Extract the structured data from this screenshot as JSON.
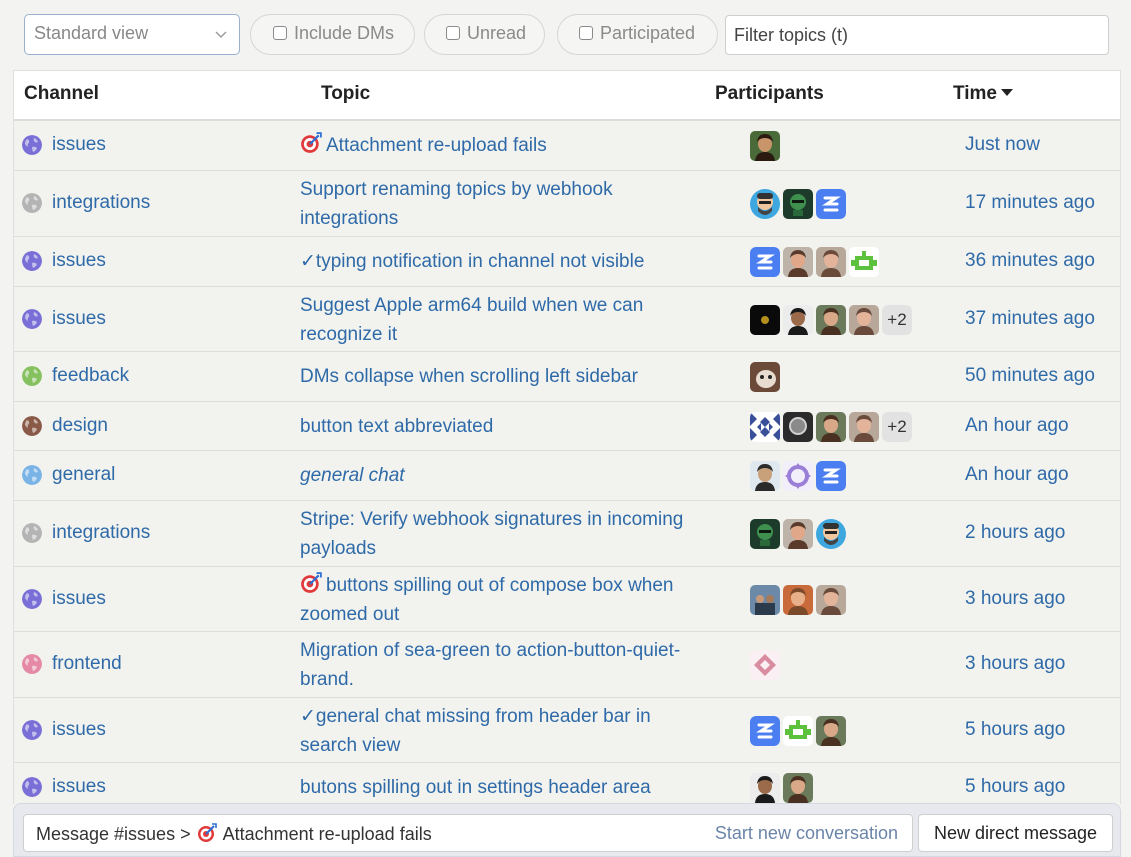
{
  "filters": {
    "view_select": "Standard view",
    "include_dms": "Include DMs",
    "unread": "Unread",
    "participated": "Participated",
    "topic_filter_placeholder": "Filter topics (t)"
  },
  "table": {
    "headers": {
      "channel": "Channel",
      "topic": "Topic",
      "participants": "Participants",
      "time": "Time"
    },
    "rows": [
      {
        "channel": "issues",
        "globe_color": "#7a6fd6",
        "topic": "Attachment re-upload fails",
        "prefix": "target-icon",
        "time": "Just now",
        "avatars": [
          "photo-man-1"
        ],
        "more": ""
      },
      {
        "channel": "integrations",
        "globe_color": "#b4b4b4",
        "topic_line1": "Support renaming topics by webhook",
        "topic_line2": "integrations",
        "time": "17 minutes ago",
        "avatars": [
          "cartoon-man",
          "green-robot",
          "zulip-logo"
        ],
        "more": ""
      },
      {
        "channel": "issues",
        "globe_color": "#7a6fd6",
        "topic": "typing notification in channel not visible",
        "prefix": "check",
        "time": "36 minutes ago",
        "avatars": [
          "zulip-logo",
          "photo-man-2",
          "photo-man-3",
          "green-pixel"
        ],
        "more": ""
      },
      {
        "channel": "issues",
        "globe_color": "#7a6fd6",
        "topic_line1": "Suggest Apple arm64 build when we can",
        "topic_line2": "recognize it",
        "time": "37 minutes ago",
        "avatars": [
          "dark-glow",
          "photo-man-4",
          "photo-woman-1",
          "photo-man-3"
        ],
        "more": "+2"
      },
      {
        "channel": "feedback",
        "globe_color": "#86c15f",
        "topic": "DMs collapse when scrolling left sidebar",
        "time": "50 minutes ago",
        "avatars": [
          "cat-photo"
        ],
        "more": ""
      },
      {
        "channel": "design",
        "globe_color": "#8a5a48",
        "topic": "button text abbreviated",
        "time": "An hour ago",
        "avatars": [
          "blue-pattern",
          "photo-dark",
          "photo-woman-1",
          "photo-man-3"
        ],
        "more": "+2"
      },
      {
        "channel": "general",
        "globe_color": "#7ab4e6",
        "topic": "general chat",
        "italic": true,
        "time": "An hour ago",
        "avatars": [
          "photo-man-5",
          "purple-pattern",
          "zulip-logo"
        ],
        "more": ""
      },
      {
        "channel": "integrations",
        "globe_color": "#b4b4b4",
        "topic_line1": "Stripe: Verify webhook signatures in incoming",
        "topic_line2": "payloads",
        "time": "2 hours ago",
        "avatars": [
          "green-robot",
          "photo-man-2",
          "cartoon-man"
        ],
        "more": ""
      },
      {
        "channel": "issues",
        "globe_color": "#7a6fd6",
        "topic_line1": "buttons spilling out of compose box when",
        "topic_line2": "zoomed out",
        "prefix": "target-icon",
        "time": "3 hours ago",
        "avatars": [
          "photo-group",
          "photo-man-6",
          "photo-man-3"
        ],
        "more": ""
      },
      {
        "channel": "frontend",
        "globe_color": "#e58aa6",
        "topic_line1": "Migration of sea-green to action-button-quiet-",
        "topic_line2": "brand.",
        "time": "3 hours ago",
        "avatars": [
          "pink-pattern"
        ],
        "more": ""
      },
      {
        "channel": "issues",
        "globe_color": "#7a6fd6",
        "topic_line1": "general chat missing from header bar in",
        "topic_line2": "search view",
        "prefix": "check",
        "time": "5 hours ago",
        "avatars": [
          "zulip-logo",
          "green-pixel",
          "photo-woman-1"
        ],
        "more": ""
      },
      {
        "channel": "issues",
        "globe_color": "#7a6fd6",
        "topic": "butons spilling out in settings header area",
        "time": "5 hours ago",
        "avatars": [
          "photo-man-4",
          "photo-woman-1"
        ],
        "more": ""
      }
    ]
  },
  "compose": {
    "prefix": "Message #issues >",
    "topic": "Attachment re-upload fails",
    "start_new": "Start new conversation",
    "new_dm": "New direct message"
  },
  "colors": {
    "link": "#2f6aa8",
    "row_bg": "#f2f3ef",
    "zulip_blue": "#4b7ef0",
    "robot_green": "#5cc23d"
  }
}
